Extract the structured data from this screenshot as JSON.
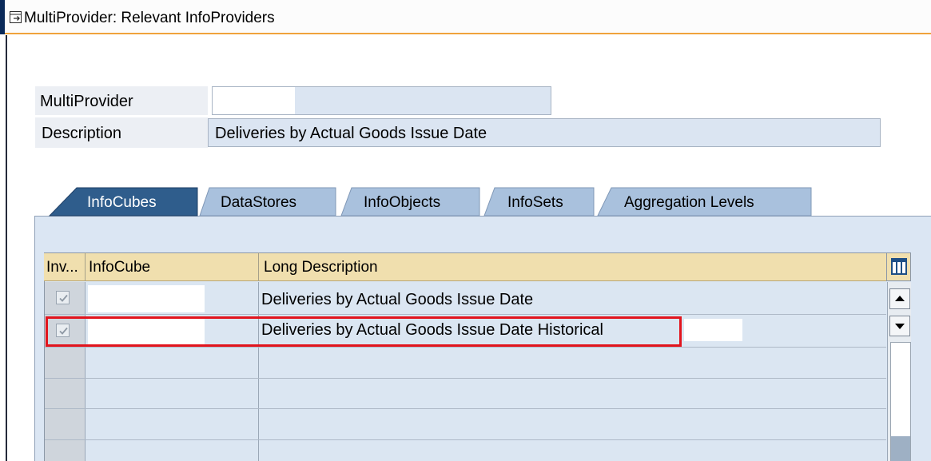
{
  "window": {
    "title": "MultiProvider: Relevant InfoProviders",
    "icon": "window-icon"
  },
  "form": {
    "multiprovider_label": "MultiProvider",
    "multiprovider_value": "",
    "description_label": "Description",
    "description_value": "Deliveries by Actual Goods Issue Date"
  },
  "tabs": [
    {
      "label": "InfoCubes",
      "active": true
    },
    {
      "label": "DataStores",
      "active": false
    },
    {
      "label": "InfoObjects",
      "active": false
    },
    {
      "label": "InfoSets",
      "active": false
    },
    {
      "label": "Aggregation Levels",
      "active": false
    }
  ],
  "table": {
    "columns": [
      "Inv...",
      "InfoCube",
      "Long Description"
    ],
    "rows": [
      {
        "checked": true,
        "infocube": "",
        "long_description": "Deliveries by Actual Goods Issue Date"
      },
      {
        "checked": true,
        "infocube": "",
        "long_description": "Deliveries by Actual Goods Issue Date Historical"
      }
    ]
  },
  "colors": {
    "header": "#f0dfae",
    "active_tab": "#2f5d8c",
    "inactive_tab": "#a9c1dd",
    "highlight": "#e2141d",
    "field": "#dbe5f2"
  },
  "icons": [
    "column-settings-icon",
    "scroll-up-icon",
    "scroll-down-icon",
    "checkmark-icon"
  ]
}
